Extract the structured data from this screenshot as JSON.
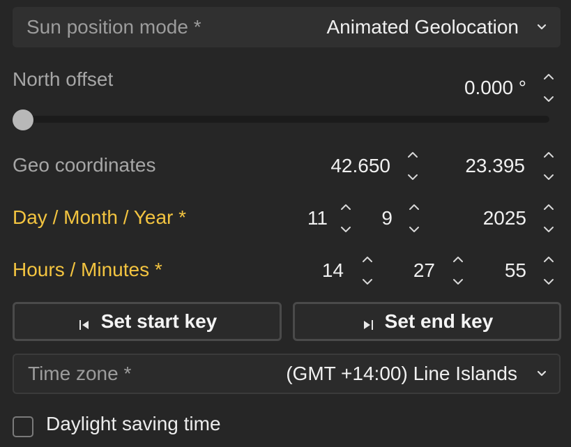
{
  "sun_mode": {
    "label": "Sun position mode *",
    "value": "Animated Geolocation"
  },
  "north_offset": {
    "label": "North offset",
    "value": "0.000 °",
    "slider_fraction": 0.0
  },
  "geo": {
    "label": "Geo coordinates",
    "latitude": "42.650",
    "longitude": "23.395"
  },
  "date": {
    "label": "Day / Month / Year *",
    "day": "11",
    "month": "9",
    "year": "2025"
  },
  "time": {
    "label": "Hours / Minutes *",
    "hours": "14",
    "minutes": "27",
    "seconds": "55"
  },
  "buttons": {
    "start": "Set start key",
    "end": "Set end key"
  },
  "timezone": {
    "label": "Time zone *",
    "value": "(GMT +14:00) Line Islands"
  },
  "daylight": {
    "label": "Daylight saving time",
    "checked": false
  },
  "colors": {
    "background": "#262626",
    "accent": "#f3c440",
    "panel": "#303030"
  }
}
